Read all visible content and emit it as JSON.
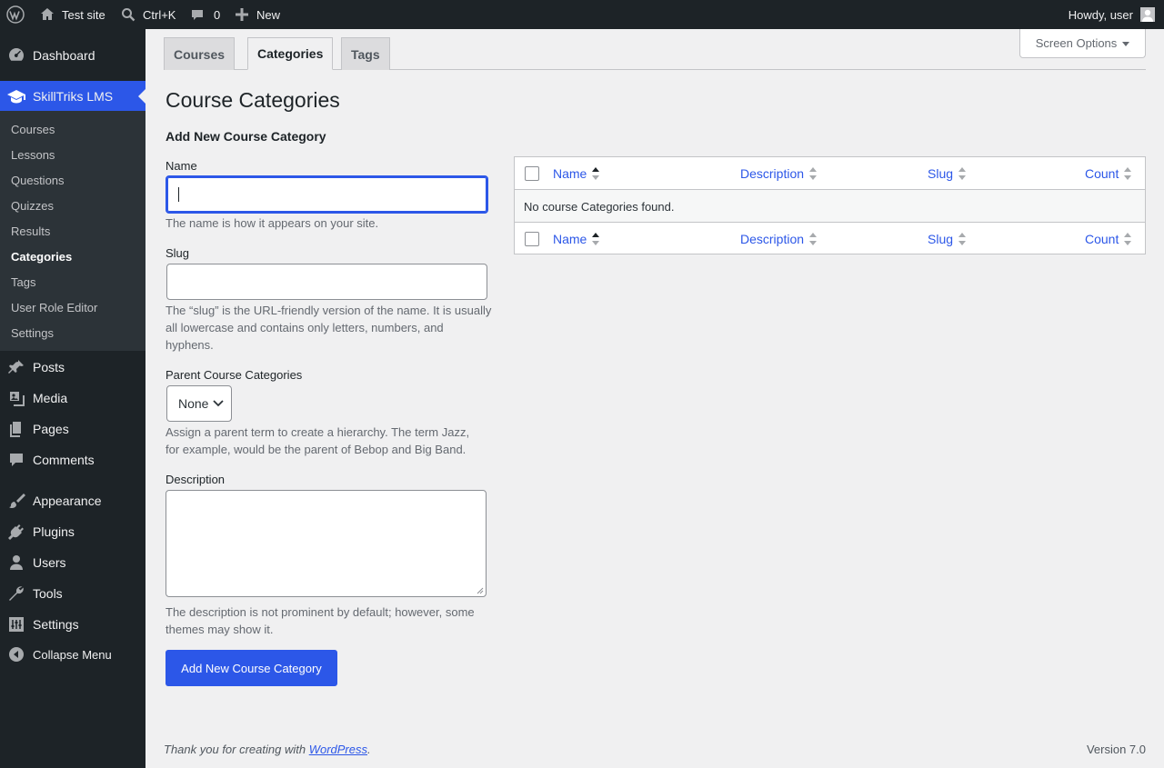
{
  "adminbar": {
    "site_name": "Test site",
    "search_shortcut": "Ctrl+K",
    "comments_count": "0",
    "new_label": "New",
    "howdy": "Howdy, user"
  },
  "sidebar": {
    "dashboard": "Dashboard",
    "plugin": "SkillTriks LMS",
    "submenu": [
      "Courses",
      "Lessons",
      "Questions",
      "Quizzes",
      "Results",
      "Categories",
      "Tags",
      "User Role Editor",
      "Settings"
    ],
    "posts": "Posts",
    "media": "Media",
    "pages": "Pages",
    "comments": "Comments",
    "appearance": "Appearance",
    "plugins": "Plugins",
    "users": "Users",
    "tools": "Tools",
    "settings": "Settings",
    "collapse": "Collapse Menu"
  },
  "tabs": [
    "Courses",
    "Categories",
    "Tags"
  ],
  "screen_options": "Screen Options",
  "page_title": "Course Categories",
  "form": {
    "heading": "Add New Course Category",
    "name_label": "Name",
    "name_value": "",
    "name_desc": "The name is how it appears on your site.",
    "slug_label": "Slug",
    "slug_value": "",
    "slug_desc": "The “slug” is the URL-friendly version of the name. It is usually all lowercase and contains only letters, numbers, and hyphens.",
    "parent_label": "Parent Course Categories",
    "parent_value": "None",
    "parent_desc": "Assign a parent term to create a hierarchy. The term Jazz, for example, would be the parent of Bebop and Big Band.",
    "description_label": "Description",
    "description_value": "",
    "description_desc": "The description is not prominent by default; however, some themes may show it.",
    "submit": "Add New Course Category"
  },
  "table": {
    "columns": [
      "Name",
      "Description",
      "Slug",
      "Count"
    ],
    "empty": "No course Categories found."
  },
  "footer": {
    "thanks_prefix": "Thank you for creating with ",
    "thanks_link": "WordPress",
    "thanks_suffix": ".",
    "version": "Version 7.0"
  },
  "colors": {
    "accent": "#2c57e8",
    "adminbar": "#1d2327",
    "background": "#f0f0f1"
  }
}
